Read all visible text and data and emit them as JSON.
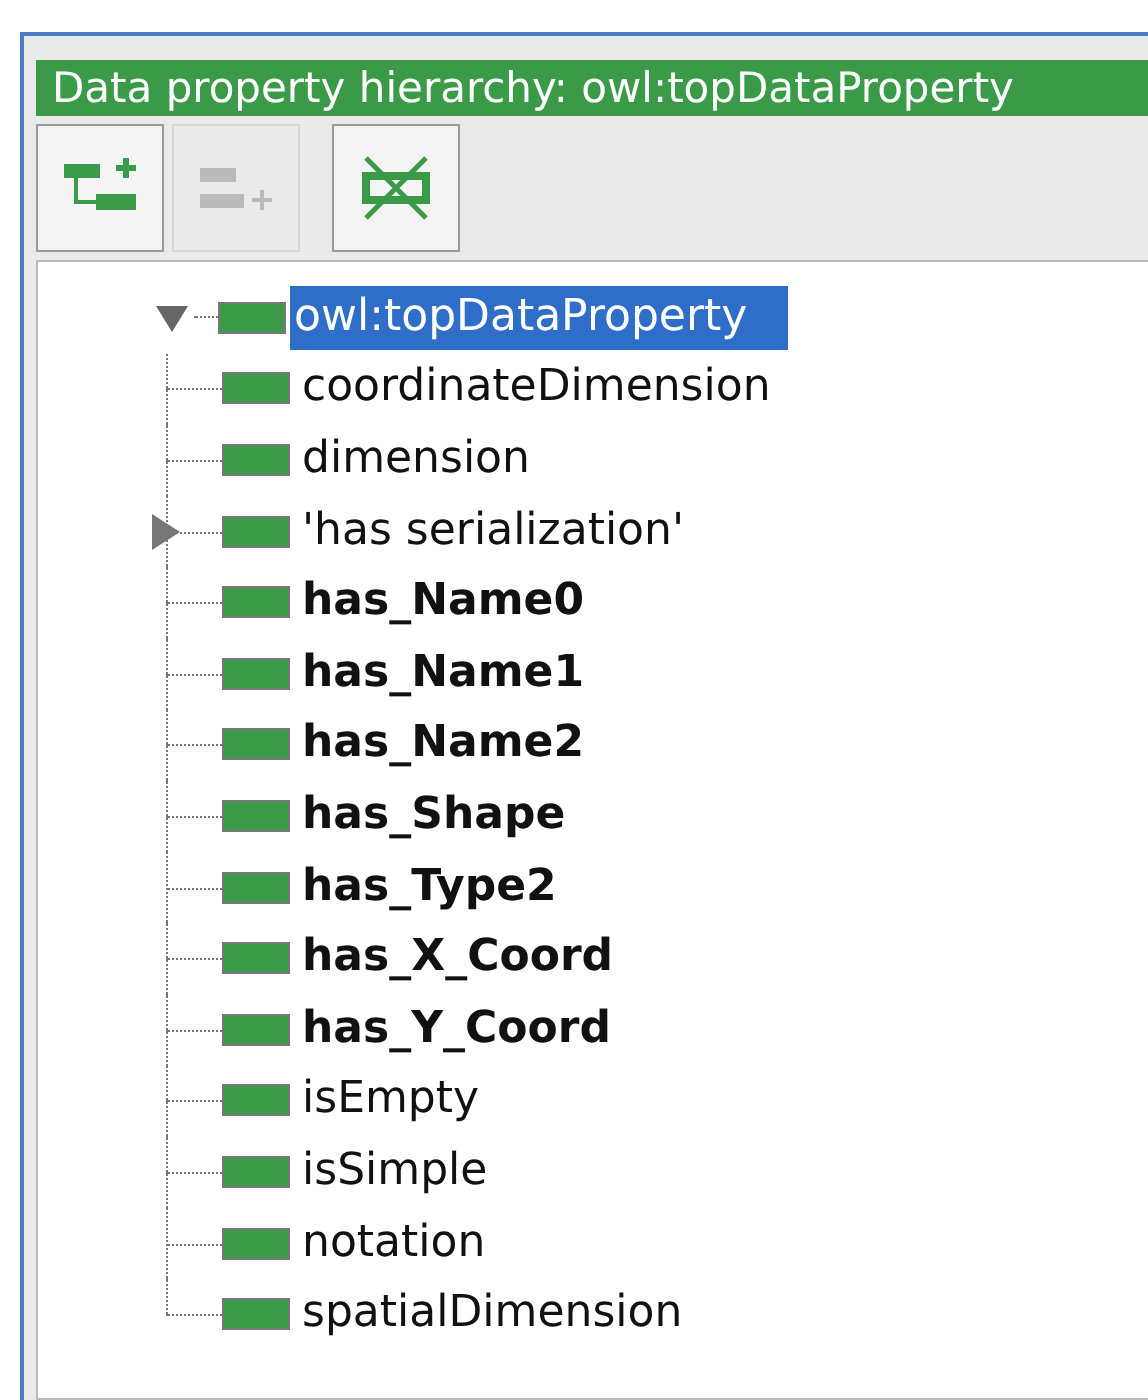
{
  "panel": {
    "title": "Data property hierarchy: owl:topDataProperty"
  },
  "toolbar": [
    {
      "disabled": false
    },
    {
      "disabled": true
    },
    {
      "disabled": false
    }
  ],
  "tree": {
    "label": "owl:topDataProperty",
    "expanded": true,
    "selected": true,
    "children": [
      {
        "label": "coordinateDimension",
        "bold": false
      },
      {
        "label": "dimension",
        "bold": false
      },
      {
        "label": "'has serialization'",
        "bold": false,
        "expanded": false
      },
      {
        "label": "has_Name0",
        "bold": true
      },
      {
        "label": "has_Name1",
        "bold": true
      },
      {
        "label": "has_Name2",
        "bold": true
      },
      {
        "label": "has_Shape",
        "bold": true
      },
      {
        "label": "has_Type2",
        "bold": true
      },
      {
        "label": "has_X_Coord",
        "bold": true
      },
      {
        "label": "has_Y_Coord",
        "bold": true
      },
      {
        "label": "isEmpty",
        "bold": false
      },
      {
        "label": "isSimple",
        "bold": false
      },
      {
        "label": "notation",
        "bold": false
      },
      {
        "label": "spatialDimension",
        "bold": false
      }
    ]
  }
}
